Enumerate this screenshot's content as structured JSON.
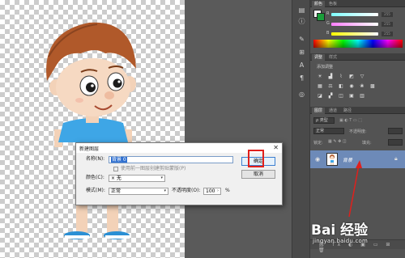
{
  "dialog": {
    "title": "新建图层",
    "close_glyph": "✕",
    "name_label": "名称(N):",
    "name_value": "背景 0",
    "clip_checkbox_label": "使用前一图层创建剪贴蒙版(P)",
    "color_label": "颜色(C):",
    "color_value": "× 无",
    "mode_label": "模式(M):",
    "mode_value": "正常",
    "opacity_label": "不透明度(O):",
    "opacity_value": "100",
    "opacity_unit": "%",
    "ok_label": "确定",
    "cancel_label": "取消"
  },
  "panels": {
    "color_tabs": [
      "颜色",
      "色板"
    ],
    "rgb_labels": [
      "R",
      "G",
      "B"
    ],
    "rgb_values": [
      "255",
      "255",
      "255"
    ],
    "adjust_tabs": [
      "调整",
      "样式"
    ],
    "adjust_title": "添加调整",
    "layers_tabs": [
      "图层",
      "通道",
      "路径"
    ],
    "kind_filter": "ρ 类型",
    "blend_mode": "正常",
    "opacity_label": "不透明度:",
    "lock_label": "锁定:",
    "fill_label": "填充:",
    "layer_name": "背景"
  },
  "icons": {
    "eye": "eye-icon",
    "lock": "lock-icon",
    "close": "close-icon"
  },
  "watermark": {
    "logo": "Bai 经验",
    "url": "jingyan.baidu.com"
  },
  "colors": {
    "highlight": "#e0201c",
    "layer_selected": "#6d8ab8",
    "foreground_swatch": "#ffffff",
    "background_swatch": "#1a9e3a"
  }
}
